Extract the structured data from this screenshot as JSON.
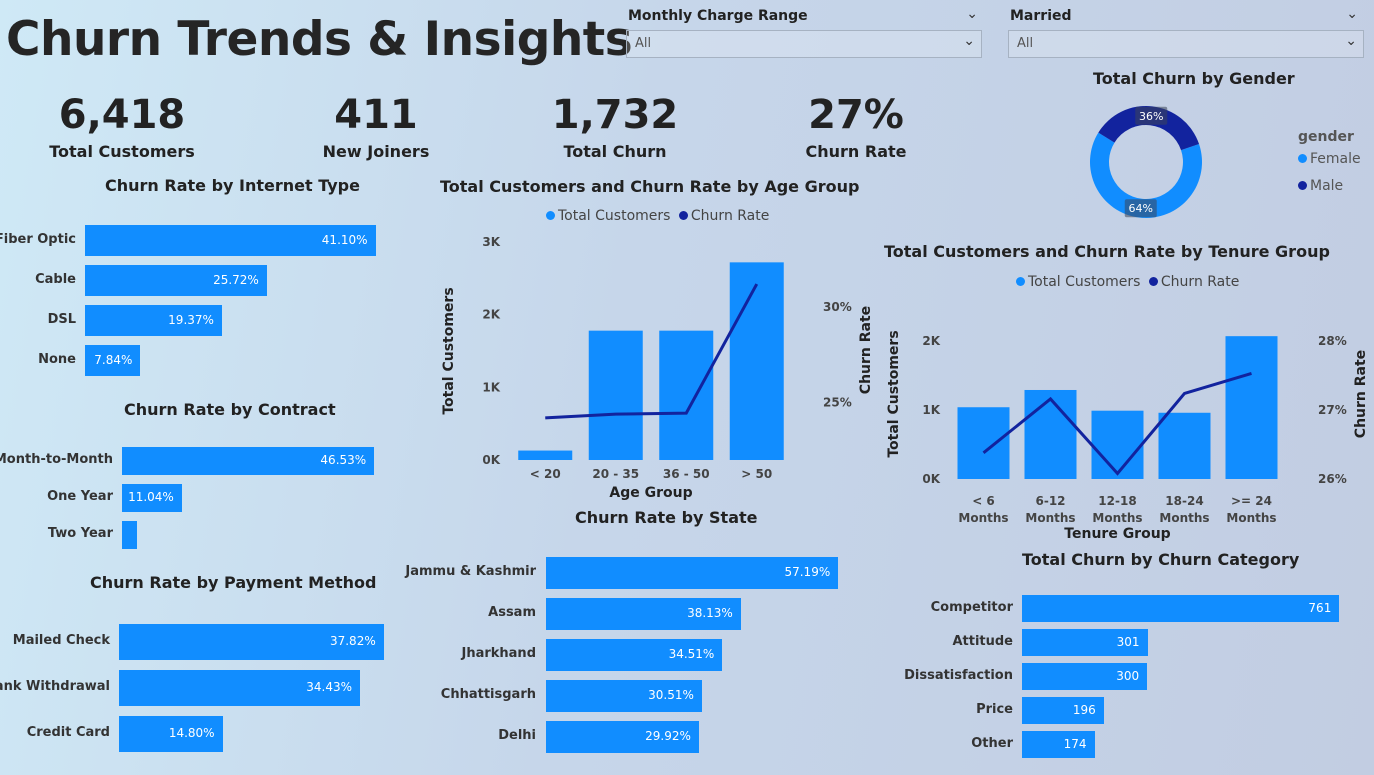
{
  "title": "Churn Trends & Insights",
  "slicers": [
    {
      "label": "Monthly Charge Range",
      "value": "All"
    },
    {
      "label": "Married",
      "value": "All"
    }
  ],
  "kpis": [
    {
      "value": "6,418",
      "label": "Total Customers"
    },
    {
      "value": "411",
      "label": "New Joiners"
    },
    {
      "value": "1,732",
      "label": "Total Churn"
    },
    {
      "value": "27%",
      "label": "Churn Rate"
    }
  ],
  "colors": {
    "bar": "#118dff",
    "line": "#12239e",
    "female": "#118dff",
    "male": "#12239e"
  },
  "chart_data": [
    {
      "id": "internet",
      "type": "bar",
      "orientation": "horizontal",
      "title": "Churn Rate by Internet Type",
      "categories": [
        "Fiber Optic",
        "Cable",
        "DSL",
        "None"
      ],
      "values": [
        41.1,
        25.72,
        19.37,
        7.84
      ],
      "labels": [
        "41.10%",
        "25.72%",
        "19.37%",
        "7.84%"
      ]
    },
    {
      "id": "contract",
      "type": "bar",
      "orientation": "horizontal",
      "title": "Churn Rate by Contract",
      "categories": [
        "Month-to-Month",
        "One Year",
        "Two Year"
      ],
      "values": [
        46.53,
        11.04,
        2.8
      ],
      "labels": [
        "46.53%",
        "11.04%",
        ""
      ]
    },
    {
      "id": "payment",
      "type": "bar",
      "orientation": "horizontal",
      "title": "Churn Rate by Payment Method",
      "categories": [
        "Mailed Check",
        "Bank Withdrawal",
        "Credit Card"
      ],
      "values": [
        37.82,
        34.43,
        14.8
      ],
      "labels": [
        "37.82%",
        "34.43%",
        "14.80%"
      ]
    },
    {
      "id": "state",
      "type": "bar",
      "orientation": "horizontal",
      "title": "Churn Rate by State",
      "categories": [
        "Jammu & Kashmir",
        "Assam",
        "Jharkhand",
        "Chhattisgarh",
        "Delhi"
      ],
      "values": [
        57.19,
        38.13,
        34.51,
        30.51,
        29.92
      ],
      "labels": [
        "57.19%",
        "38.13%",
        "34.51%",
        "30.51%",
        "29.92%"
      ]
    },
    {
      "id": "category",
      "type": "bar",
      "orientation": "horizontal",
      "title": "Total Churn by Churn Category",
      "categories": [
        "Competitor",
        "Attitude",
        "Dissatisfaction",
        "Price",
        "Other"
      ],
      "values": [
        761,
        301,
        300,
        196,
        174
      ],
      "labels": [
        "761",
        "301",
        "300",
        "196",
        "174"
      ]
    },
    {
      "id": "age",
      "type": "bar+line",
      "title": "Total Customers and Churn Rate by Age Group",
      "categories": [
        "< 20",
        "20 - 35",
        "36 - 50",
        "> 50"
      ],
      "series": [
        {
          "name": "Total Customers",
          "type": "bar",
          "axis": "left",
          "values": [
            130,
            1780,
            1780,
            2720
          ]
        },
        {
          "name": "Churn Rate",
          "type": "line",
          "axis": "right",
          "values": [
            24.2,
            24.4,
            24.45,
            31.2
          ]
        }
      ],
      "xlabel": "Age Group",
      "ylabel": "Total Customers",
      "y2label": "Churn Rate",
      "ylim": [
        0,
        3000
      ],
      "y_ticks": [
        "0K",
        "1K",
        "2K",
        "3K"
      ],
      "y2_ticks": [
        "25%",
        "30%"
      ],
      "y2_tick_values": [
        25,
        30
      ],
      "y2lim": [
        22.0,
        33.4
      ]
    },
    {
      "id": "tenure",
      "type": "bar+line",
      "title": "Total Customers and Churn Rate by Tenure Group",
      "categories": [
        "< 6 Months",
        "6-12 Months",
        "12-18 Months",
        "18-24 Months",
        ">= 24 Months"
      ],
      "series": [
        {
          "name": "Total Customers",
          "type": "bar",
          "axis": "left",
          "values": [
            1040,
            1290,
            990,
            960,
            2070
          ]
        },
        {
          "name": "Churn Rate",
          "type": "line",
          "axis": "right",
          "values": [
            26.38,
            27.16,
            26.08,
            27.24,
            27.53
          ]
        }
      ],
      "xlabel": "Tenure Group",
      "ylabel": "Total Customers",
      "y2label": "Churn Rate",
      "ylim": [
        0,
        2000
      ],
      "y_ticks": [
        "0K",
        "1K",
        "2K"
      ],
      "y2_ticks": [
        "26%",
        "27%",
        "28%"
      ],
      "y2_tick_values": [
        26,
        27,
        28
      ],
      "y2lim": [
        26,
        28
      ]
    },
    {
      "id": "gender",
      "type": "pie",
      "title": "Total Churn by Gender",
      "legend_title": "gender",
      "categories": [
        "Female",
        "Male"
      ],
      "values": [
        64,
        36
      ],
      "labels": [
        "64%",
        "36%"
      ]
    }
  ]
}
